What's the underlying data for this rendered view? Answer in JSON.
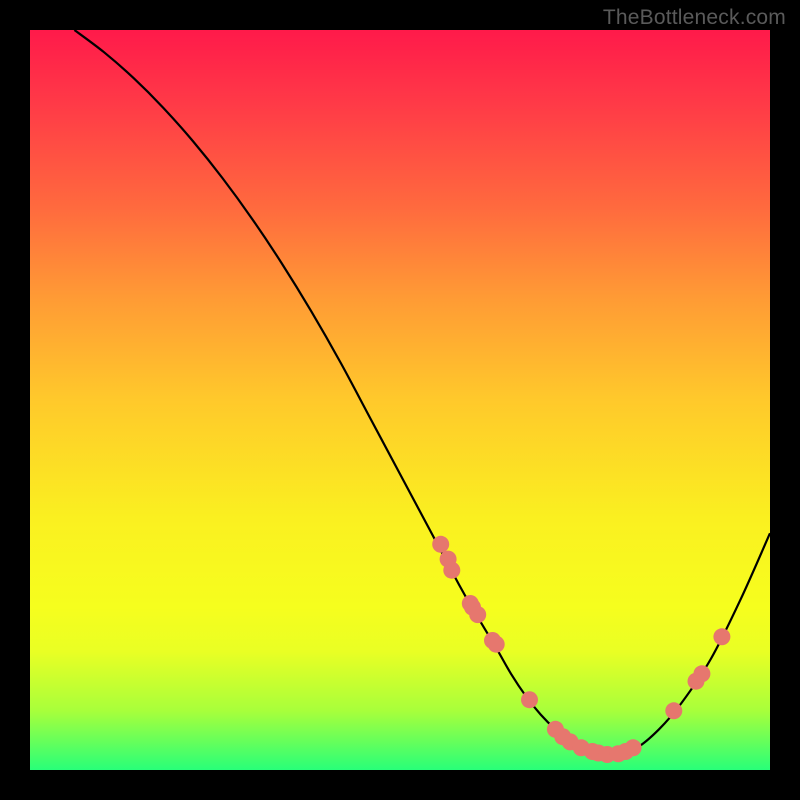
{
  "credit": "TheBottleneck.com",
  "colors": {
    "curve_stroke": "#000000",
    "point_fill": "#e6776e",
    "point_stroke": "#c95a54"
  },
  "chart_data": {
    "type": "line",
    "title": "",
    "xlabel": "",
    "ylabel": "",
    "xlim": [
      0,
      100
    ],
    "ylim": [
      0,
      100
    ],
    "series": [
      {
        "name": "bottleneck-curve",
        "x": [
          6,
          10,
          14,
          18,
          22,
          26,
          30,
          34,
          38,
          42,
          46,
          50,
          54,
          58,
          60,
          63,
          65,
          67,
          69,
          71,
          73,
          76,
          79,
          82,
          85,
          88,
          92,
          96,
          100
        ],
        "y": [
          100,
          97,
          93.5,
          89.5,
          85,
          80,
          74.5,
          68.5,
          62,
          55,
          47.5,
          40,
          32.5,
          25,
          21.5,
          16.5,
          13,
          10,
          7.5,
          5.5,
          4,
          2.5,
          2,
          3,
          5.5,
          9,
          15,
          23,
          32
        ]
      }
    ],
    "points": [
      {
        "x": 55.5,
        "y": 30.5
      },
      {
        "x": 56.5,
        "y": 28.5
      },
      {
        "x": 57.0,
        "y": 27.0
      },
      {
        "x": 59.5,
        "y": 22.5
      },
      {
        "x": 59.8,
        "y": 22.0
      },
      {
        "x": 60.5,
        "y": 21.0
      },
      {
        "x": 62.5,
        "y": 17.5
      },
      {
        "x": 63.0,
        "y": 17.0
      },
      {
        "x": 67.5,
        "y": 9.5
      },
      {
        "x": 71.0,
        "y": 5.5
      },
      {
        "x": 72.0,
        "y": 4.5
      },
      {
        "x": 73.0,
        "y": 3.8
      },
      {
        "x": 74.5,
        "y": 3.0
      },
      {
        "x": 76.0,
        "y": 2.5
      },
      {
        "x": 76.8,
        "y": 2.3
      },
      {
        "x": 78.0,
        "y": 2.1
      },
      {
        "x": 79.5,
        "y": 2.2
      },
      {
        "x": 80.5,
        "y": 2.5
      },
      {
        "x": 81.5,
        "y": 3.0
      },
      {
        "x": 87.0,
        "y": 8.0
      },
      {
        "x": 90.0,
        "y": 12.0
      },
      {
        "x": 90.8,
        "y": 13.0
      },
      {
        "x": 93.5,
        "y": 18.0
      }
    ]
  }
}
